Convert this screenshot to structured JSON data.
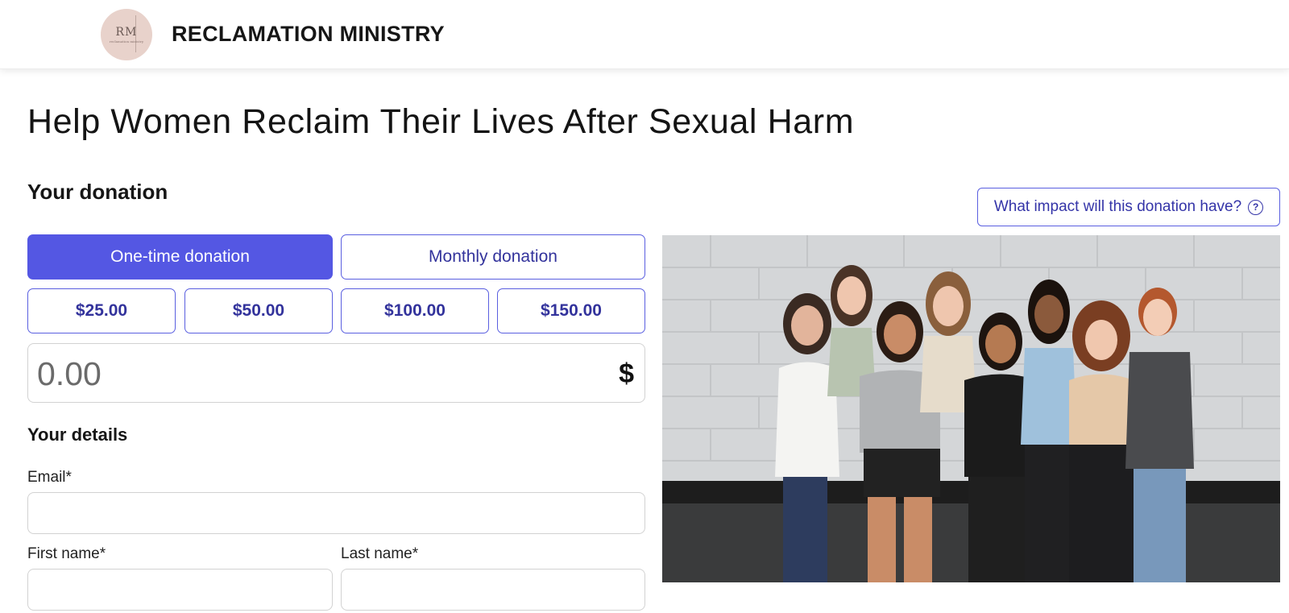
{
  "header": {
    "logo_mark": "RM",
    "logo_sub": "reclamation ministry",
    "org_name": "RECLAMATION MINISTRY"
  },
  "page": {
    "title": "Help Women Reclaim Their Lives After Sexual Harm"
  },
  "donation": {
    "section_title": "Your donation",
    "impact_label": "What impact will this donation have?",
    "impact_icon": "question-circle-icon",
    "frequency": [
      {
        "label": "One-time donation",
        "selected": true
      },
      {
        "label": "Monthly donation",
        "selected": false
      }
    ],
    "amounts": [
      "$25.00",
      "$50.00",
      "$100.00",
      "$150.00"
    ],
    "custom_amount_placeholder": "0.00",
    "currency_symbol": "$"
  },
  "details": {
    "section_title": "Your details",
    "email_label": "Email*",
    "first_name_label": "First name*",
    "last_name_label": "Last name*"
  },
  "colors": {
    "accent": "#5457e3",
    "accent_text": "#33339c",
    "border": "#d2d2d2"
  }
}
